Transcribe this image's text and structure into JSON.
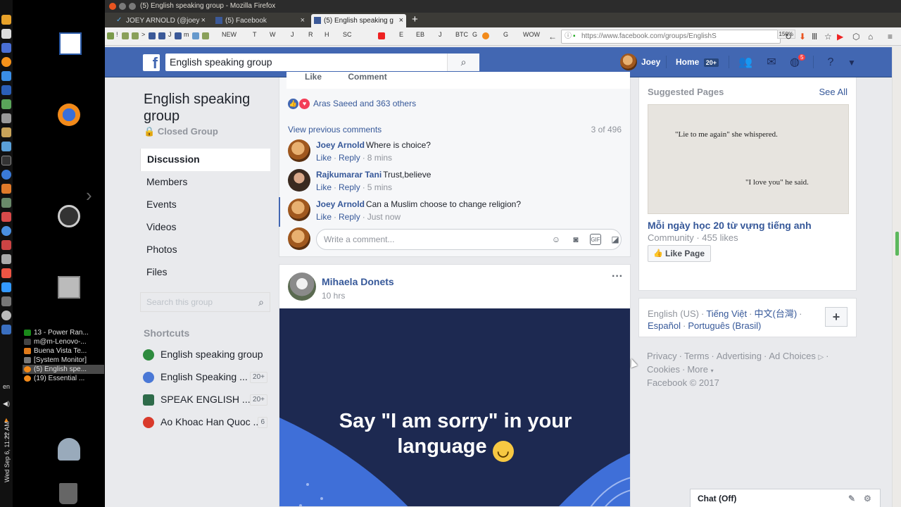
{
  "window": {
    "title": "(5) English speaking group - Mozilla Firefox",
    "tabs": [
      {
        "label": "JOEY ARNOLD (@joey",
        "active": false
      },
      {
        "label": "(5) Facebook",
        "active": false
      },
      {
        "label": "(5) English speaking g",
        "active": true
      }
    ],
    "new_tab": "+",
    "url": "https://www.facebook.com/groups/EnglishS",
    "zoom": "150%"
  },
  "bookmarks": [
    "!",
    ">",
    "J",
    "m",
    "NEW",
    "T",
    "W",
    "J",
    "R",
    "H",
    "SC",
    "E",
    "EB",
    "J",
    "BTC",
    "G",
    "G",
    "WOW"
  ],
  "desktop": {
    "tasks": [
      {
        "label": "13 - Power Ran...",
        "active": false
      },
      {
        "label": "m@m-Lenovo-...",
        "active": false
      },
      {
        "label": "Buena Vista Te...",
        "active": false
      },
      {
        "label": "[System Monitor]",
        "active": false
      },
      {
        "label": "(5) English spe...",
        "active": true
      },
      {
        "label": "(19) Essential ...",
        "active": false
      }
    ],
    "keyboard_layout": "en",
    "clock": "Wed Sep 6, 11:22 AM"
  },
  "fb_header": {
    "logo": "f",
    "search_value": "English speaking group",
    "user_name": "Joey",
    "home_label": "Home",
    "home_count": "20+",
    "notification_count": "5"
  },
  "group": {
    "title": "English speaking group",
    "privacy": "Closed Group",
    "nav": [
      "Discussion",
      "Members",
      "Events",
      "Videos",
      "Photos",
      "Files"
    ],
    "search_placeholder": "Search this group",
    "shortcuts_heading": "Shortcuts",
    "shortcuts": [
      {
        "label": "English speaking group",
        "badge": "",
        "color": "#2e8b3e"
      },
      {
        "label": "English Speaking ...",
        "badge": "20+",
        "color": "#4a78d6"
      },
      {
        "label": "SPEAK ENGLISH ...",
        "badge": "20+",
        "color": "#2e6b4a"
      },
      {
        "label": "Ao Khoac Han Quoc ...",
        "badge": "6",
        "color": "#d93a2b"
      }
    ]
  },
  "post1": {
    "like_label": "Like",
    "comment_label": "Comment",
    "reactions_text": "Aras Saeed and 363 others",
    "view_previous": "View previous comments",
    "comment_count": "3 of 496",
    "comments": [
      {
        "name": "Joey Arnold",
        "text": "Where is choice?",
        "like": "Like",
        "reply": "Reply",
        "time": "8 mins"
      },
      {
        "name": "Rajkumarar Tani",
        "text": "Trust,believe",
        "like": "Like",
        "reply": "Reply",
        "time": "5 mins"
      },
      {
        "name": "Joey Arnold",
        "text": "Can a Muslim choose to change religion?",
        "like": "Like",
        "reply": "Reply",
        "time": "Just now"
      }
    ],
    "write_placeholder": "Write a comment..."
  },
  "post2": {
    "author": "Mihaela Donets",
    "time": "10 hrs",
    "image_text_line1": "Say \"I am sorry\" in your",
    "image_text_line2": "language"
  },
  "sidebar": {
    "suggested_heading": "Suggested Pages",
    "see_all": "See All",
    "quote1": "\"Lie to me again\" she whispered.",
    "quote2": "\"I love you\" he said.",
    "page_name": "Mỗi ngày học 20 từ vựng tiếng anh",
    "page_meta": "Community · 455 likes",
    "like_page": "Like Page",
    "languages": {
      "current": "English (US)",
      "others": [
        "Tiếng Việt",
        "中文(台灣)",
        "Español",
        "Português (Brasil)"
      ]
    },
    "footer_links": [
      "Privacy",
      "Terms",
      "Advertising",
      "Ad Choices",
      "Cookies",
      "More"
    ],
    "copyright": "Facebook © 2017"
  },
  "chat": {
    "label": "Chat (Off)"
  }
}
